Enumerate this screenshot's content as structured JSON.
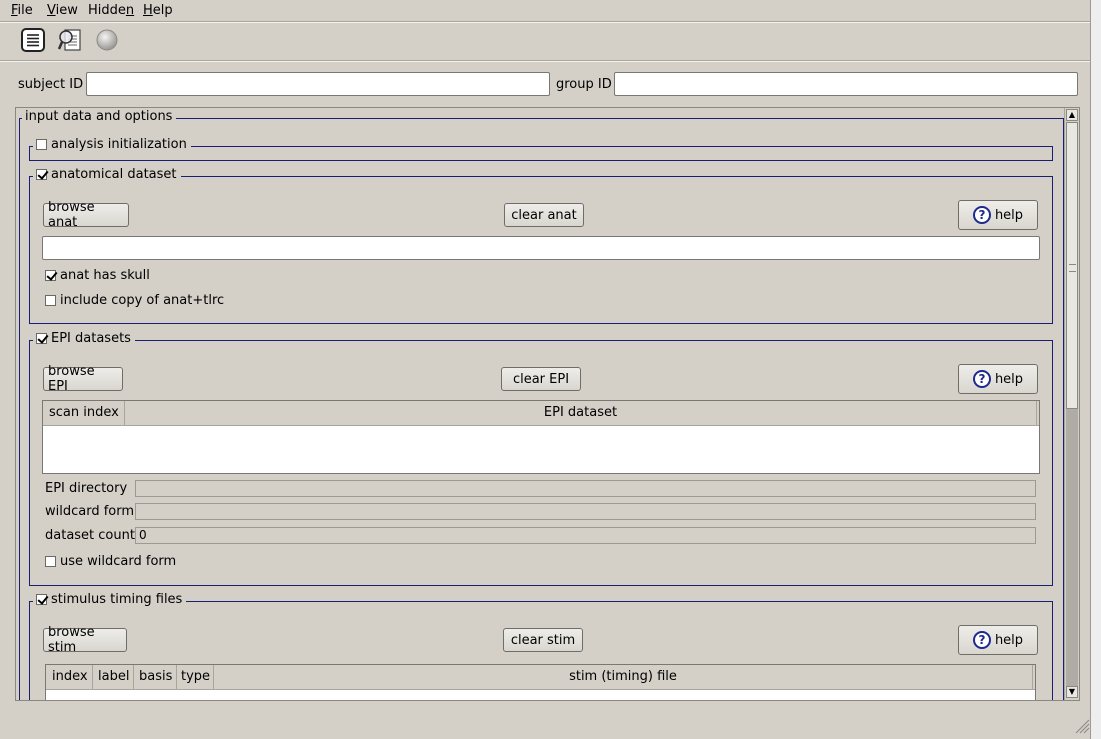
{
  "menu": {
    "items": [
      {
        "label": "File",
        "u": "F",
        "rest": "ile"
      },
      {
        "label": "View",
        "u": "V",
        "rest": "iew"
      },
      {
        "label": "Hidden",
        "pre": "Hidde",
        "u": "n"
      },
      {
        "label": "Help",
        "u": "H",
        "rest": "elp"
      }
    ]
  },
  "toolbar": {
    "icons": [
      "document-list-icon",
      "search-document-icon",
      "disabled-circle-icon"
    ]
  },
  "ids": {
    "subject_label": "subject ID",
    "subject_value": "",
    "group_label": "group ID",
    "group_value": ""
  },
  "main": {
    "title": "input data and options",
    "analysis_init": {
      "label": "analysis initialization",
      "checked": false
    },
    "anat": {
      "label": "anatomical dataset",
      "checked": true,
      "browse": "browse anat",
      "clear": "clear anat",
      "help": "help",
      "path_value": "",
      "opt_skull": "anat has skull",
      "opt_skull_checked": true,
      "opt_copy": "include copy of anat+tlrc",
      "opt_copy_checked": false
    },
    "epi": {
      "label": "EPI datasets",
      "checked": true,
      "browse": "browse EPI",
      "clear": "clear EPI",
      "help": "help",
      "col_index": "scan index",
      "col_dataset": "EPI dataset",
      "dir_label": "EPI directory",
      "dir_value": "",
      "wildcard_label": "wildcard form",
      "wildcard_value": "",
      "count_label": "dataset count",
      "count_value": "0",
      "use_wildcard": "use wildcard form",
      "use_wildcard_checked": false
    },
    "stim": {
      "label": "stimulus timing files",
      "checked": true,
      "browse": "browse stim",
      "clear": "clear stim",
      "help": "help",
      "cols": [
        "index",
        "label",
        "basis",
        "type",
        "stim (timing) file"
      ]
    }
  },
  "colors": {
    "window_bg": "#d4d0c8",
    "group_border": "#1b1f74",
    "help_icon": "#1e2a8c"
  }
}
